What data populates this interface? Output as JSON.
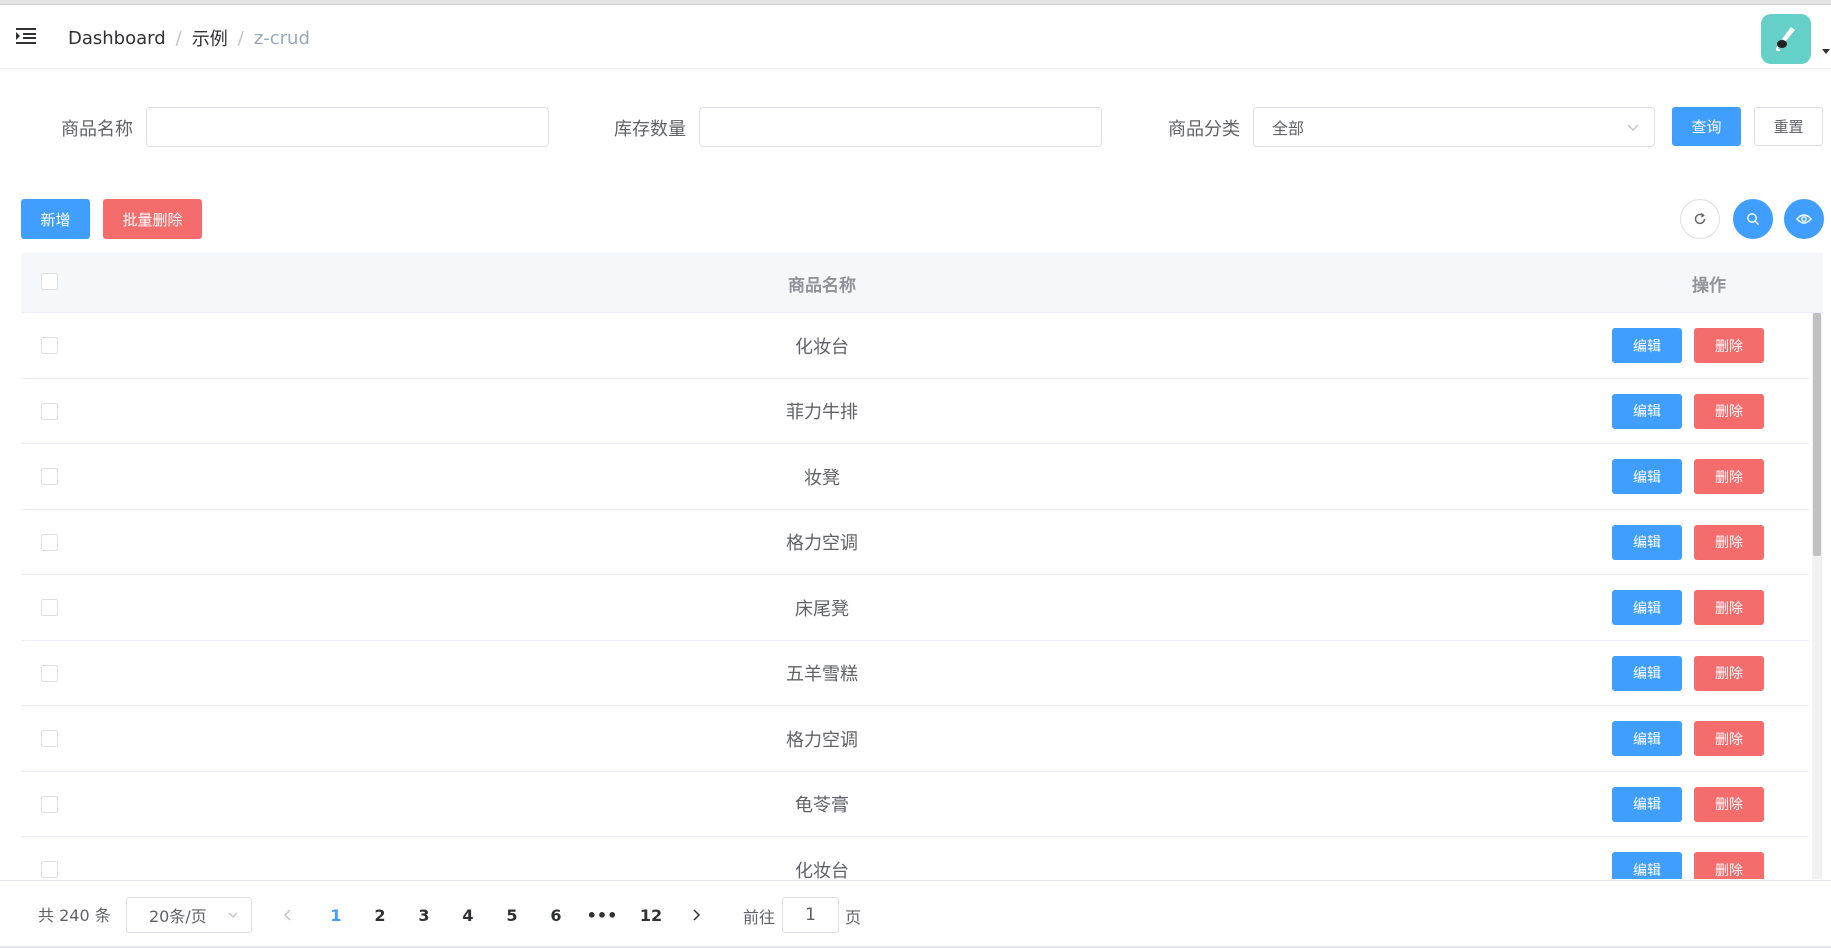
{
  "header": {
    "breadcrumb": [
      "Dashboard",
      "示例",
      "z-crud"
    ],
    "avatar_color": "#64d0c8"
  },
  "search_form": {
    "product_name_label": "商品名称",
    "product_name_value": "",
    "stock_label": "库存数量",
    "stock_value": "",
    "category_label": "商品分类",
    "category_value": "全部",
    "query_label": "查询",
    "reset_label": "重置"
  },
  "toolbar": {
    "add_label": "新增",
    "batch_delete_label": "批量删除",
    "refresh_icon": "refresh-icon",
    "search_icon": "search-icon",
    "column_icon": "eye-icon"
  },
  "table": {
    "columns": [
      "商品名称",
      "操作"
    ],
    "rows": [
      {
        "name": "化妆台"
      },
      {
        "name": "菲力牛排"
      },
      {
        "name": "妆凳"
      },
      {
        "name": "格力空调"
      },
      {
        "name": "床尾凳"
      },
      {
        "name": "五羊雪糕"
      },
      {
        "name": "格力空调"
      },
      {
        "name": "龟苓膏"
      },
      {
        "name": "化妆台"
      }
    ],
    "edit_label": "编辑",
    "delete_label": "删除"
  },
  "pagination": {
    "total_text": "共 240 条",
    "page_size": "20条/页",
    "pages": [
      "1",
      "2",
      "3",
      "4",
      "5",
      "6",
      "•••",
      "12"
    ],
    "current_page": "1",
    "goto_label": "前往",
    "goto_value": "1",
    "goto_suffix": "页"
  },
  "colors": {
    "primary": "#409eff",
    "danger": "#f56c6c",
    "border": "#dcdfe6"
  }
}
